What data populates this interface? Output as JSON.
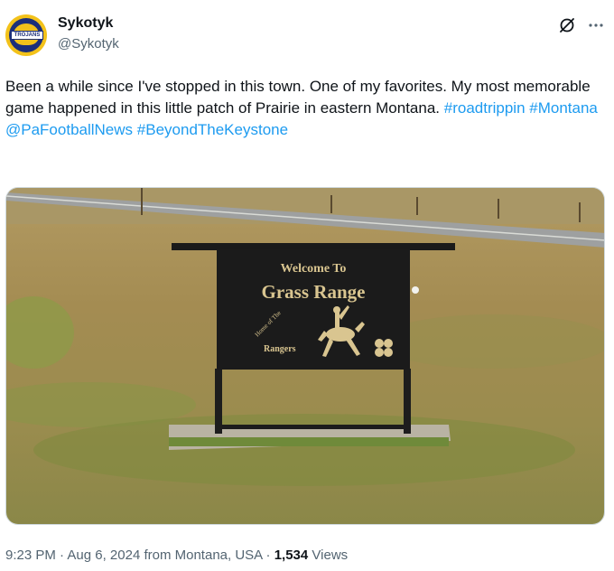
{
  "author": {
    "name": "Sykotyk",
    "handle": "@Sykotyk",
    "avatar_badge": "TROJANS"
  },
  "tweet": {
    "text_plain": "Been a while since I've stopped in this town. One of my favorites. My most memorable game happened in this little patch of Prairie in eastern Montana. ",
    "hashtags": [
      "#roadtrippin",
      "#Montana",
      "@PaFootballNews",
      "#BeyondTheKeystone"
    ]
  },
  "photo": {
    "sign_line1": "Welcome To",
    "sign_line2": "Grass Range",
    "sign_arc": "Home of The",
    "sign_team": "Rangers"
  },
  "meta": {
    "time": "9:23 PM",
    "sep1": " · ",
    "date": "Aug 6, 2024",
    "location": " from Montana, USA",
    "sep2": " · ",
    "views_count": "1,534",
    "views_label": " Views"
  },
  "icons": [
    "grok-icon",
    "more-icon"
  ],
  "colors": {
    "link": "#1d9bf0",
    "secondary": "#536471",
    "text": "#0f1419"
  }
}
